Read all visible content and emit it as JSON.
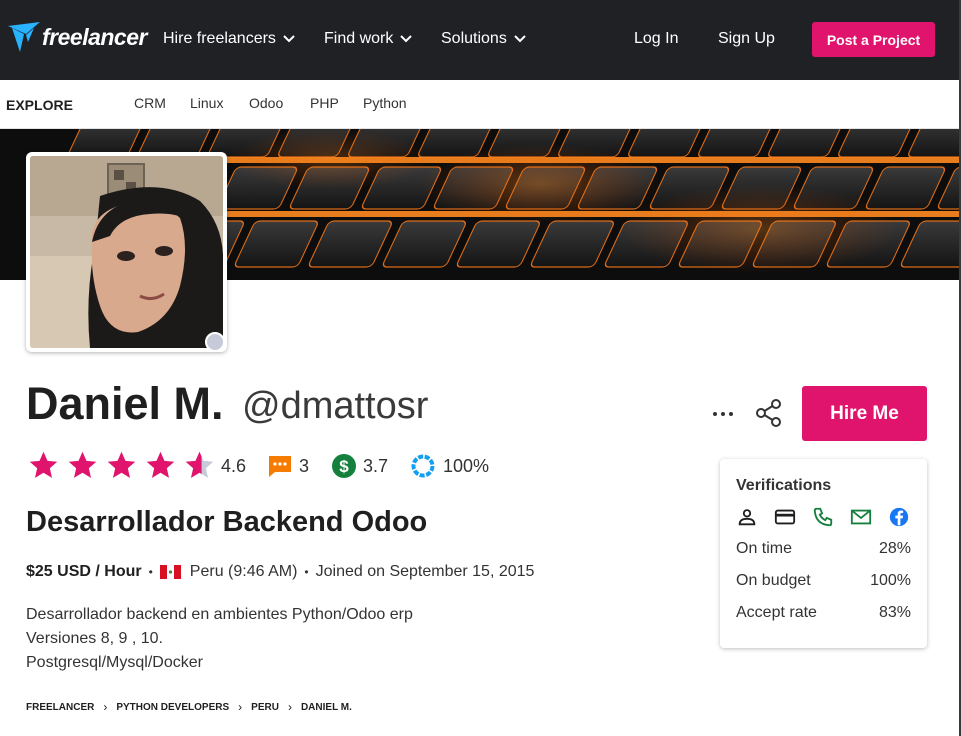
{
  "brand": {
    "name": "freelancer",
    "accent": "#e0136d",
    "nav_bg": "#1f2125"
  },
  "nav": {
    "items": [
      {
        "label": "Hire freelancers"
      },
      {
        "label": "Find work"
      },
      {
        "label": "Solutions"
      }
    ],
    "login": "Log In",
    "signup": "Sign Up",
    "post_project": "Post a Project"
  },
  "explore": {
    "label": "EXPLORE",
    "links": [
      "CRM",
      "Linux",
      "Odoo",
      "PHP",
      "Python"
    ]
  },
  "profile": {
    "name": "Daniel M.",
    "username": "@dmattosr",
    "hire_label": "Hire Me",
    "rating": "4.6",
    "rating_value": 4.6,
    "reviews": "3",
    "earnings_score": "3.7",
    "completion": "100%",
    "headline": "Desarrollador Backend Odoo",
    "rate": "$25 USD / Hour",
    "location": "Peru (9:46 AM)",
    "joined": "Joined on September 15, 2015",
    "description": [
      "Desarrollador backend en ambientes Python/Odoo erp",
      "Versiones 8, 9 , 10.",
      "Postgresql/Mysql/Docker"
    ]
  },
  "verifications": {
    "title": "Verifications",
    "icons": [
      "user-icon",
      "credit-card-icon",
      "phone-icon",
      "email-icon",
      "facebook-icon"
    ],
    "rows": [
      {
        "label": "On time",
        "value": "28%"
      },
      {
        "label": "On budget",
        "value": "100%"
      },
      {
        "label": "Accept rate",
        "value": "83%"
      }
    ]
  },
  "breadcrumbs": [
    "FREELANCER",
    "PYTHON DEVELOPERS",
    "PERU",
    "DANIEL M."
  ]
}
